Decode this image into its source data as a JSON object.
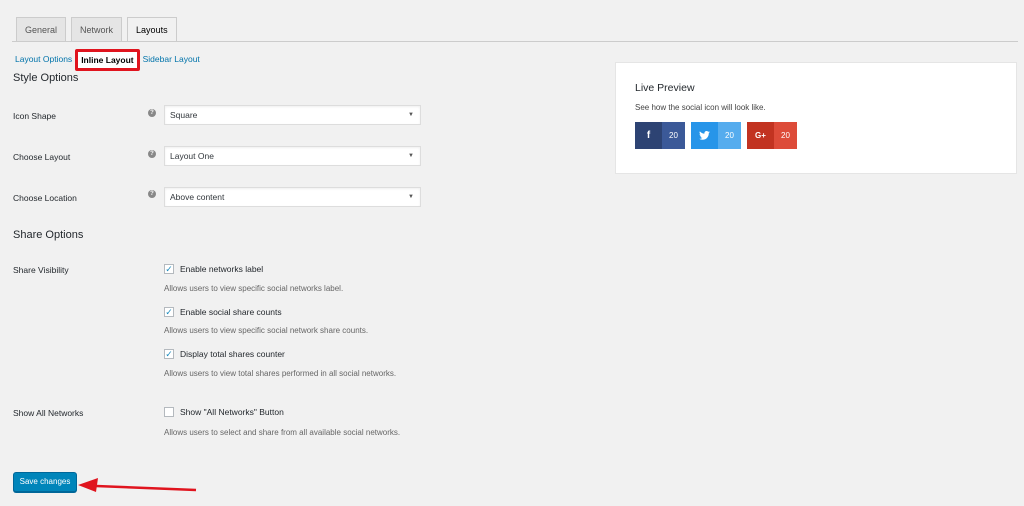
{
  "tabs": [
    {
      "label": "General"
    },
    {
      "label": "Network"
    },
    {
      "label": "Layouts"
    }
  ],
  "subnav": {
    "layout_options": "Layout Options",
    "inline_layout": "Inline Layout",
    "sidebar_layout": "Sidebar Layout"
  },
  "style_options": {
    "title": "Style Options",
    "icon_shape": {
      "label": "Icon Shape",
      "value": "Square"
    },
    "choose_layout": {
      "label": "Choose Layout",
      "value": "Layout One"
    },
    "choose_location": {
      "label": "Choose Location",
      "value": "Above content"
    }
  },
  "share_options": {
    "title": "Share Options",
    "visibility_label": "Share Visibility",
    "items": [
      {
        "label": "Enable networks label",
        "desc": "Allows users to view specific social networks label.",
        "checked": true
      },
      {
        "label": "Enable social share counts",
        "desc": "Allows users to view specific social network share counts.",
        "checked": true
      },
      {
        "label": "Display total shares counter",
        "desc": "Allows users to view total shares performed in all social networks.",
        "checked": true
      }
    ],
    "all_networks_label": "Show All Networks",
    "all_networks": {
      "label": "Show \"All Networks\" Button",
      "desc": "Allows users to select and share from all available social networks.",
      "checked": false
    }
  },
  "save_label": "Save changes",
  "preview": {
    "title": "Live Preview",
    "desc": "See how the social icon will look like.",
    "buttons": [
      {
        "icon": "f",
        "count": "20",
        "icon_bg": "#2d4373",
        "count_bg": "#3b5998"
      },
      {
        "icon": "🐦",
        "count": "20",
        "icon_bg": "#2795e9",
        "count_bg": "#55acee"
      },
      {
        "icon": "G+",
        "count": "20",
        "icon_bg": "#c23321",
        "count_bg": "#dd4b39"
      }
    ]
  },
  "colors": {
    "accent": "#0085ba",
    "highlight": "#e0141e"
  }
}
